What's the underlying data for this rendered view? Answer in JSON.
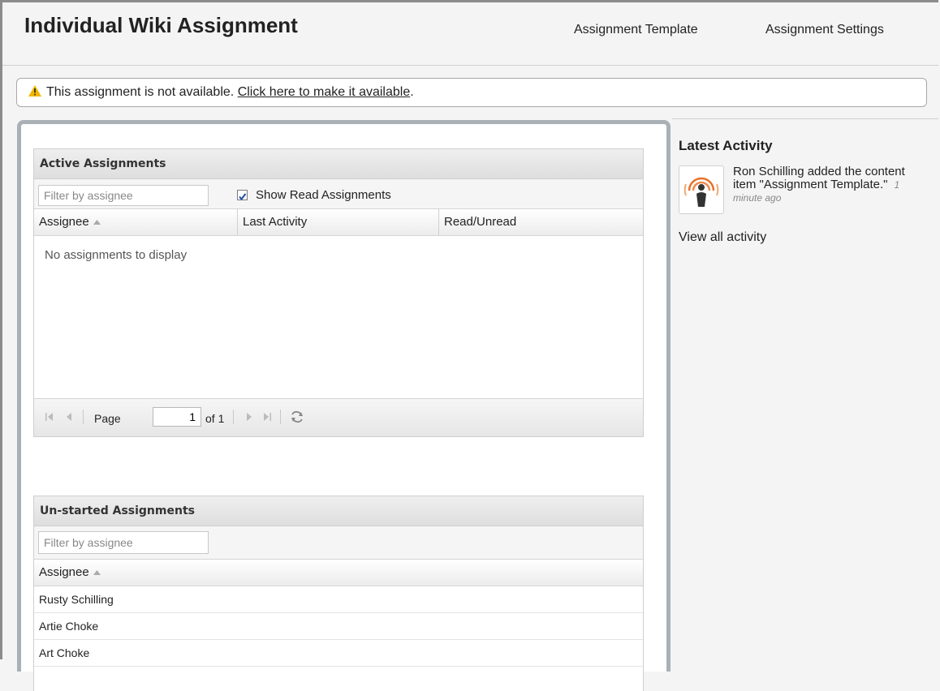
{
  "header": {
    "title": "Individual Wiki Assignment",
    "links": [
      "Assignment Template",
      "Assignment Settings"
    ]
  },
  "notice": {
    "text": "This assignment is not available.",
    "link": "Click here to make it available",
    "suffix": "."
  },
  "active": {
    "title": "Active Assignments",
    "filter_placeholder": "Filter by assignee",
    "show_read_label": "Show Read Assignments",
    "show_read_checked": true,
    "columns": [
      "Assignee",
      "Last Activity",
      "Read/Unread"
    ],
    "empty_text": "No assignments to display",
    "pager": {
      "page_label": "Page",
      "page_value": "1",
      "of_label": "of 1"
    }
  },
  "unstarted": {
    "title": "Un-started Assignments",
    "filter_placeholder": "Filter by assignee",
    "columns": [
      "Assignee"
    ],
    "rows": [
      "Rusty Schilling",
      "Artie Choke",
      "Art Choke"
    ]
  },
  "activity": {
    "title": "Latest Activity",
    "item_text": "Ron Schilling added the content item \"Assignment Template.\"",
    "item_time": "1 minute ago",
    "view_all": "View all activity"
  },
  "colors": {
    "panel_border": "#a9b1b7",
    "warning": "#f2b600",
    "avatar_orange": "#e8702a"
  }
}
